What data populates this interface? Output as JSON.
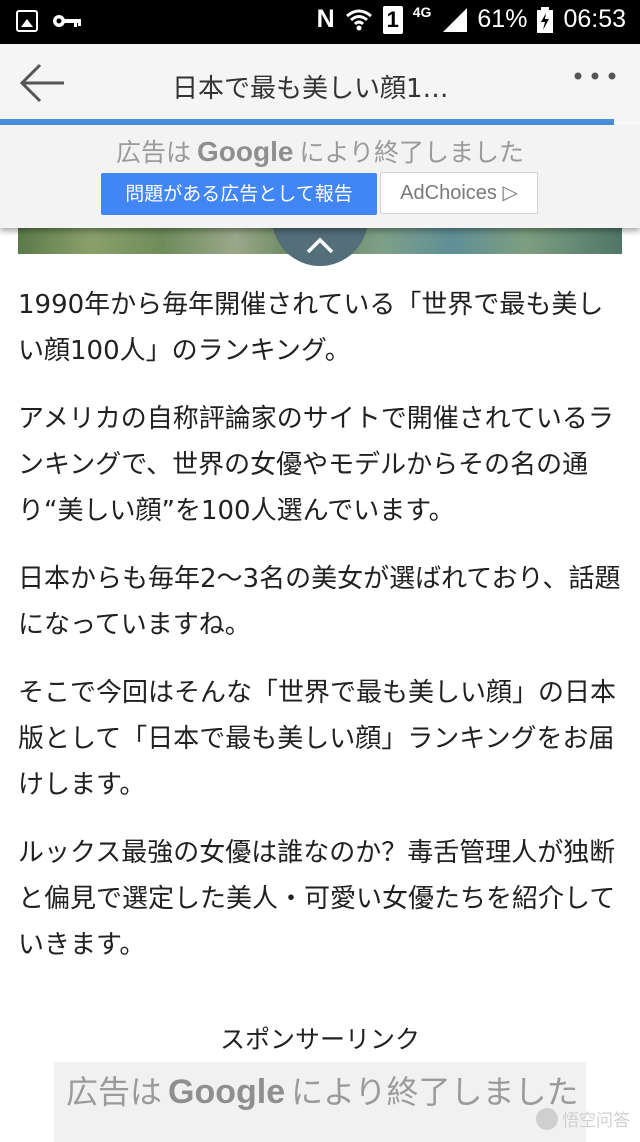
{
  "status_bar": {
    "battery_percent": "61%",
    "time": "06:53",
    "network": "4G",
    "sim": "1",
    "n_label": "N"
  },
  "toolbar": {
    "title": "日本で最も美しい顔1…"
  },
  "ad_overlay": {
    "closed_prefix": "広告は",
    "closed_brand": "Google",
    "closed_suffix": "により終了しました",
    "report_label": "問題がある広告として報告",
    "adchoices_label": "AdChoices ▷"
  },
  "article": {
    "paragraphs": [
      "1990年から毎年開催されている「世界で最も美しい顔100人」のランキング。",
      "アメリカの自称評論家のサイトで開催されているランキングで、世界の女優やモデルからその名の通り“美しい顔”を100人選んでいます。",
      "日本からも毎年2〜3名の美女が選ばれており、話題になっていますね。",
      "そこで今回はそんな「世界で最も美しい顔」の日本版として「日本で最も美しい顔」ランキングをお届けします。",
      "ルックス最強の女優は誰なのか？毒舌管理人が独断と偏見で選定した美人・可愛い女優たちを紹介していきます。"
    ]
  },
  "sponsor": {
    "label": "スポンサーリンク"
  },
  "ad_bottom": {
    "prefix": "広告は",
    "brand": "Google",
    "suffix": "により終了しました"
  },
  "watermark": {
    "text": "悟空问答"
  },
  "colors": {
    "accent": "#4285f4",
    "progress": "#4a8fdc",
    "collapse_tab": "#546e7a"
  }
}
